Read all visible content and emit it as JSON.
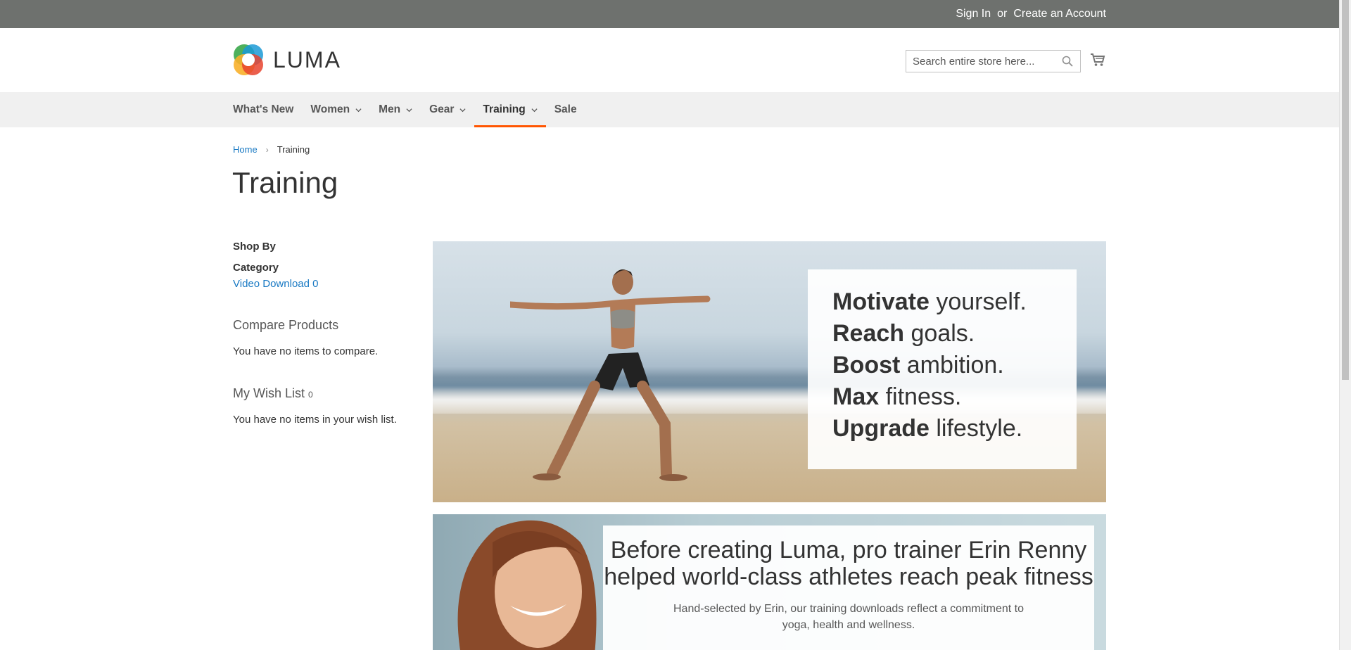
{
  "panel": {
    "sign_in": "Sign In",
    "or": "or",
    "create_account": "Create an Account"
  },
  "header": {
    "logo_text": "LUMA",
    "search_placeholder": "Search entire store here..."
  },
  "nav": {
    "items": [
      {
        "label": "What's New",
        "dropdown": false
      },
      {
        "label": "Women",
        "dropdown": true
      },
      {
        "label": "Men",
        "dropdown": true
      },
      {
        "label": "Gear",
        "dropdown": true
      },
      {
        "label": "Training",
        "dropdown": true,
        "active": true
      },
      {
        "label": "Sale",
        "dropdown": false
      }
    ],
    "accent_color": "#ff5501"
  },
  "breadcrumbs": {
    "home": "Home",
    "current": "Training"
  },
  "page_title": "Training",
  "sidebar": {
    "shop_by": "Shop By",
    "category_title": "Category",
    "category_item": {
      "label": "Video Download",
      "count": "0"
    },
    "compare_title": "Compare Products",
    "compare_text": "You have no items to compare.",
    "wishlist_title": "My Wish List",
    "wishlist_count": "0",
    "wishlist_text": "You have no items in your wish list."
  },
  "banner1": {
    "lines": [
      {
        "bold": "Motivate",
        "rest": " yourself."
      },
      {
        "bold": "Reach",
        "rest": " goals."
      },
      {
        "bold": "Boost",
        "rest": " ambition."
      },
      {
        "bold": "Max",
        "rest": " fitness."
      },
      {
        "bold": "Upgrade",
        "rest": " lifestyle."
      }
    ]
  },
  "banner2": {
    "heading": "Before creating Luma, pro trainer Erin Renny helped world-class athletes reach peak fitness",
    "subtext": "Hand-selected by Erin, our training downloads reflect a commitment to yoga, health and wellness."
  }
}
